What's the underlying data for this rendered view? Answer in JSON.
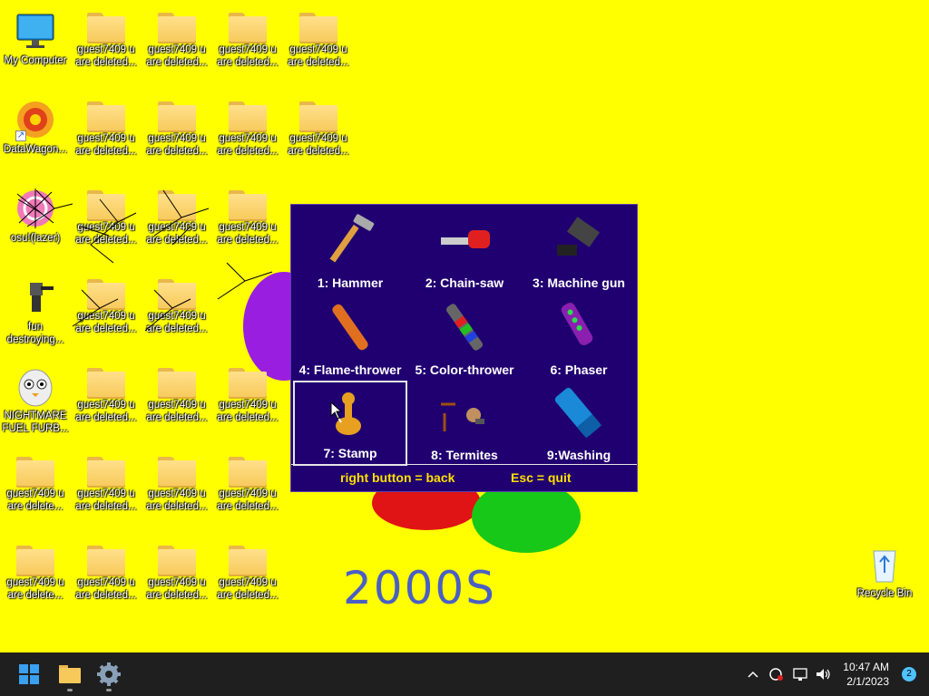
{
  "desktop": {
    "my_computer": "My Computer",
    "datawagon": "DataWagon...",
    "osu": "osu!(lazer)",
    "fun": "fun destroying...",
    "nightmare": "NIGHTMARE FUEL FURB...",
    "folder_label_a": "guest7409 u are deleted...",
    "folder_label_b": "guest7409 u are delete...",
    "recycle_bin": "Recycle Bin",
    "art_text": "2000S"
  },
  "menu": {
    "tools": [
      {
        "label": "1: Hammer"
      },
      {
        "label": "2: Chain-saw"
      },
      {
        "label": "3: Machine gun"
      },
      {
        "label": "4: Flame-thrower"
      },
      {
        "label": "5: Color-thrower"
      },
      {
        "label": "6: Phaser"
      },
      {
        "label": "7: Stamp"
      },
      {
        "label": "8: Termites"
      },
      {
        "label": "9:Washing"
      }
    ],
    "footer_back": "right button = back",
    "footer_quit": "Esc = quit"
  },
  "taskbar": {
    "time": "10:47 AM",
    "date": "2/1/2023",
    "notification_count": "2"
  },
  "colors": {
    "desktop_bg": "#ffff00",
    "menu_bg": "#200070",
    "menu_footer_text": "#ffe000",
    "taskbar_bg": "#1f1f1f"
  }
}
